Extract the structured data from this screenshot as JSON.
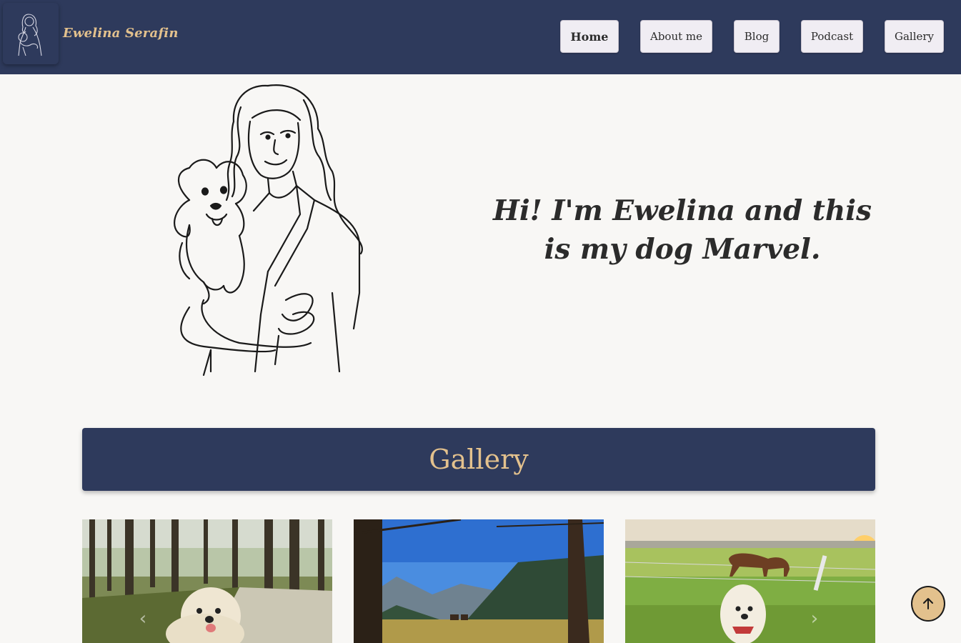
{
  "header": {
    "brand": "Ewelina Serafin",
    "nav": [
      {
        "label": "Home",
        "active": true
      },
      {
        "label": "About me"
      },
      {
        "label": "Blog"
      },
      {
        "label": "Podcast"
      },
      {
        "label": "Gallery"
      }
    ]
  },
  "hero": {
    "greeting": "Hi! I'm Ewelina and this is my dog Marvel."
  },
  "gallery": {
    "title": "Gallery",
    "photos": [
      {
        "icon": "dog-in-forest-photo"
      },
      {
        "icon": "mountain-valley-photo"
      },
      {
        "icon": "dog-with-horse-photo"
      }
    ]
  },
  "colors": {
    "navy": "#2e3a5c",
    "gold": "#e3c18d",
    "background": "#f8f7f5"
  },
  "icons": {
    "prev": "chevron-left-icon",
    "next": "chevron-right-icon",
    "scroll_top": "arrow-up-icon"
  }
}
